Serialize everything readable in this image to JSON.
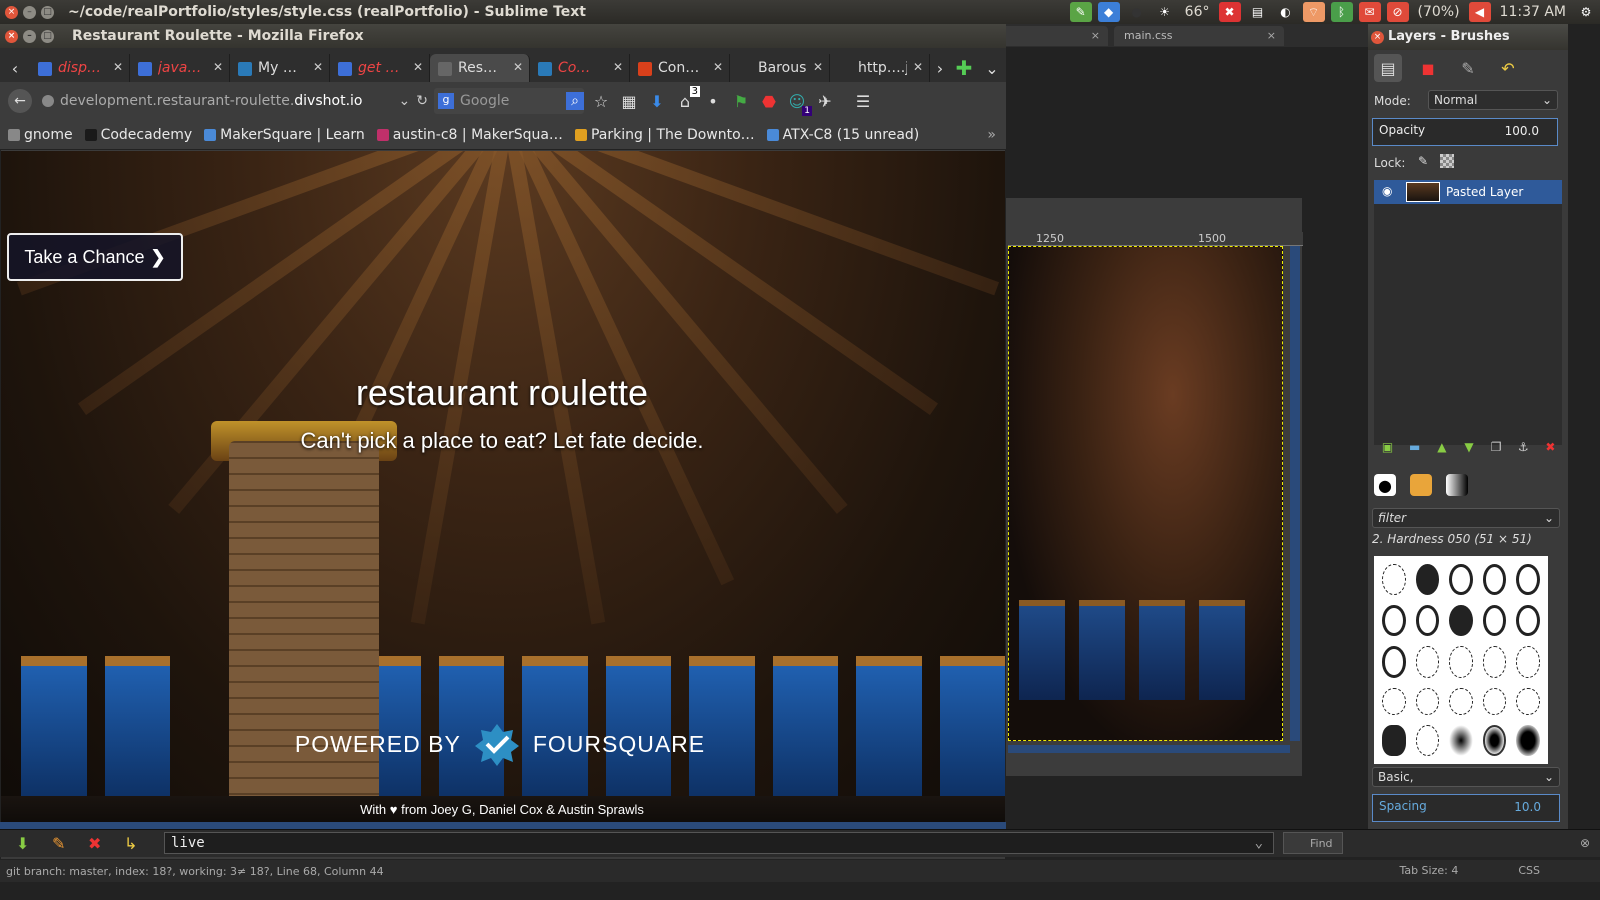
{
  "system": {
    "window_title": "~/code/realPortfolio/styles/style.css (realPortfolio) - Sublime Text",
    "temperature": "66°",
    "battery": "(70%)",
    "clock": "11:37 AM"
  },
  "sublime": {
    "tabs": [
      "main.css"
    ],
    "console_value": "live",
    "find_label": "Find",
    "status": "git branch: master, index: 18?, working: 3≠ 18?, Line 68, Column 44",
    "tab_size": "Tab Size: 4",
    "syntax": "CSS"
  },
  "gimp": {
    "ruler_ticks": [
      "1250",
      "1500"
    ],
    "panel_title": "Layers - Brushes",
    "mode_label": "Mode:",
    "mode_value": "Normal",
    "opacity_label": "Opacity",
    "opacity_value": "100.0",
    "lock_label": "Lock:",
    "layer_name": "Pasted Layer",
    "filter_placeholder": "filter",
    "brush_name": "2. Hardness 050 (51 × 51)",
    "brush_set": "Basic,",
    "spacing_label": "Spacing",
    "spacing_value": "10.0"
  },
  "firefox": {
    "window_title": "Restaurant Roulette - Mozilla Firefox",
    "tabs": [
      {
        "label": "disp…",
        "color": "#3d6fd8",
        "style": "red"
      },
      {
        "label": "java…",
        "color": "#3d6fd8",
        "style": "red"
      },
      {
        "label": "My …",
        "color": "#2a7ab8",
        "style": ""
      },
      {
        "label": "get …",
        "color": "#3d6fd8",
        "style": "red"
      },
      {
        "label": "Res…",
        "color": "#666",
        "style": "active"
      },
      {
        "label": "Co…",
        "color": "#2a7ab8",
        "style": "red"
      },
      {
        "label": "Con…",
        "color": "#d9401b",
        "style": ""
      },
      {
        "label": "Barous…",
        "color": "#2e2e2e",
        "style": ""
      },
      {
        "label": "http….js",
        "color": "#2e2e2e",
        "style": ""
      }
    ],
    "url_prefix": "development.restaurant-roulette.",
    "url_domain": "divshot.io",
    "search_placeholder": "Google",
    "home_badge": "3",
    "ext_badge": "1",
    "bookmarks": [
      {
        "label": "gnome",
        "color": "#888"
      },
      {
        "label": "Codecademy",
        "color": "#1a1a1a"
      },
      {
        "label": "MakerSquare | Learn",
        "color": "#4a8ad8"
      },
      {
        "label": "austin-c8 | MakerSqua…",
        "color": "#c0306a"
      },
      {
        "label": "Parking | The Downto…",
        "color": "#e0a020"
      },
      {
        "label": "ATX-C8 (15 unread)",
        "color": "#4a8ad8"
      }
    ]
  },
  "page": {
    "cta_label": "Take a Chance",
    "title": "restaurant roulette",
    "subtitle": "Can't pick a place to eat? Let fate decide.",
    "powered_by": "POWERED BY",
    "brand": "FOURSQUARE",
    "credits": "With ♥ from Joey G, Daniel Cox & Austin Sprawls"
  }
}
